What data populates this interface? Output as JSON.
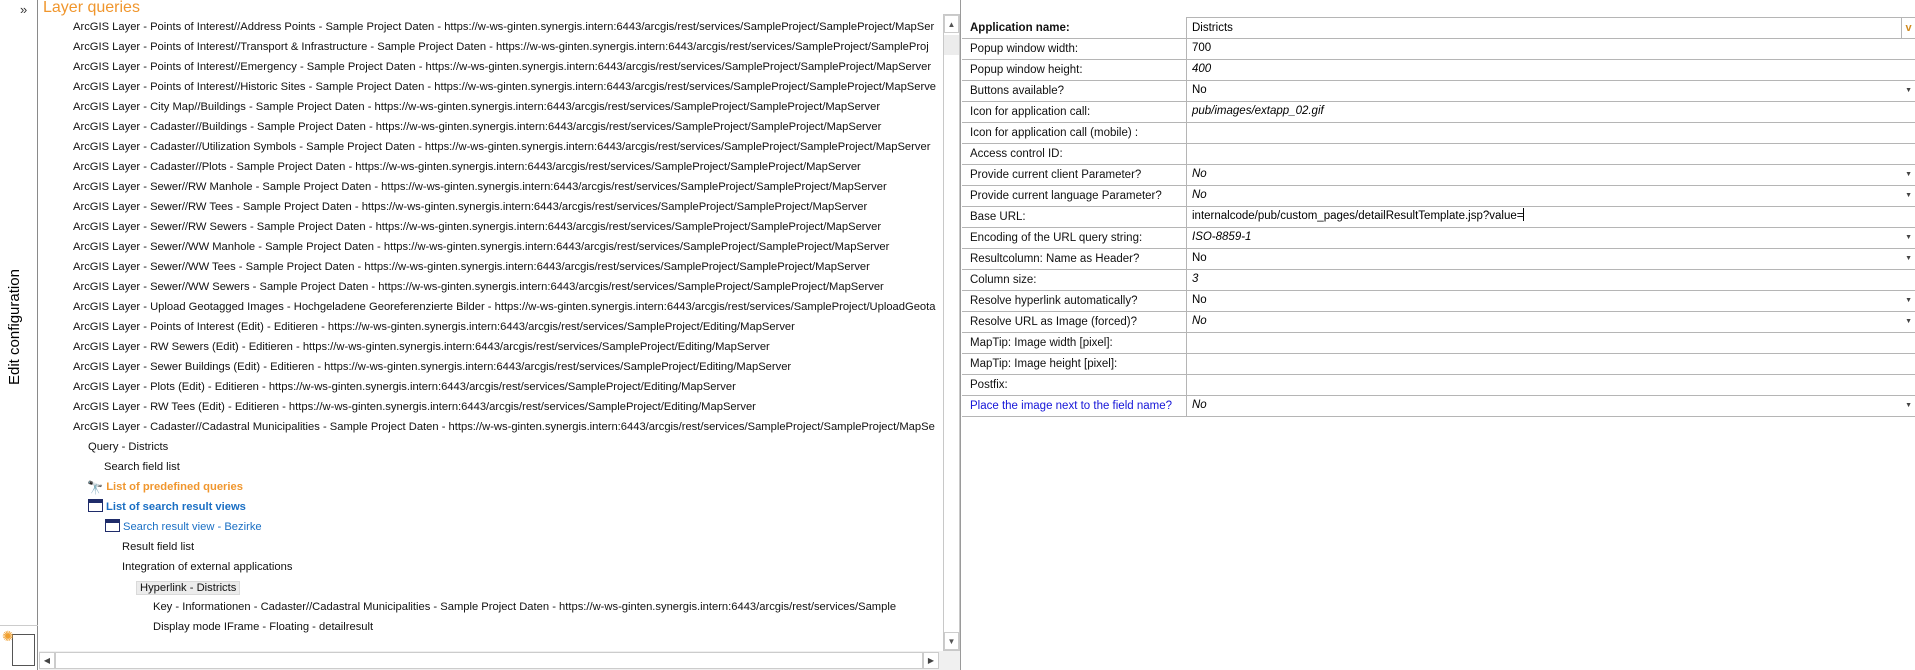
{
  "sidebar": {
    "expand_label": "»",
    "vertical_label": "Edit configuration"
  },
  "tree": {
    "title": "Layer queries",
    "layers": [
      "ArcGIS Layer - Points of Interest//Address Points - Sample Project Daten - https://w-ws-ginten.synergis.intern:6443/arcgis/rest/services/SampleProject/SampleProject/MapSer",
      "ArcGIS Layer - Points of Interest//Transport & Infrastructure - Sample Project Daten - https://w-ws-ginten.synergis.intern:6443/arcgis/rest/services/SampleProject/SampleProj",
      "ArcGIS Layer - Points of Interest//Emergency - Sample Project Daten - https://w-ws-ginten.synergis.intern:6443/arcgis/rest/services/SampleProject/SampleProject/MapServer",
      "ArcGIS Layer - Points of Interest//Historic Sites - Sample Project Daten - https://w-ws-ginten.synergis.intern:6443/arcgis/rest/services/SampleProject/SampleProject/MapServe",
      "ArcGIS Layer - City Map//Buildings - Sample Project Daten - https://w-ws-ginten.synergis.intern:6443/arcgis/rest/services/SampleProject/SampleProject/MapServer",
      "ArcGIS Layer - Cadaster//Buildings - Sample Project Daten - https://w-ws-ginten.synergis.intern:6443/arcgis/rest/services/SampleProject/SampleProject/MapServer",
      "ArcGIS Layer - Cadaster//Utilization Symbols - Sample Project Daten - https://w-ws-ginten.synergis.intern:6443/arcgis/rest/services/SampleProject/SampleProject/MapServer",
      "ArcGIS Layer - Cadaster//Plots - Sample Project Daten - https://w-ws-ginten.synergis.intern:6443/arcgis/rest/services/SampleProject/SampleProject/MapServer",
      "ArcGIS Layer - Sewer//RW Manhole - Sample Project Daten - https://w-ws-ginten.synergis.intern:6443/arcgis/rest/services/SampleProject/SampleProject/MapServer",
      "ArcGIS Layer - Sewer//RW Tees - Sample Project Daten - https://w-ws-ginten.synergis.intern:6443/arcgis/rest/services/SampleProject/SampleProject/MapServer",
      "ArcGIS Layer - Sewer//RW Sewers - Sample Project Daten - https://w-ws-ginten.synergis.intern:6443/arcgis/rest/services/SampleProject/SampleProject/MapServer",
      "ArcGIS Layer - Sewer//WW Manhole - Sample Project Daten - https://w-ws-ginten.synergis.intern:6443/arcgis/rest/services/SampleProject/SampleProject/MapServer",
      "ArcGIS Layer - Sewer//WW Tees - Sample Project Daten - https://w-ws-ginten.synergis.intern:6443/arcgis/rest/services/SampleProject/SampleProject/MapServer",
      "ArcGIS Layer - Sewer//WW Sewers - Sample Project Daten - https://w-ws-ginten.synergis.intern:6443/arcgis/rest/services/SampleProject/SampleProject/MapServer",
      "ArcGIS Layer - Upload Geotagged Images - Hochgeladene Georeferenzierte Bilder - https://w-ws-ginten.synergis.intern:6443/arcgis/rest/services/SampleProject/UploadGeota",
      "ArcGIS Layer - Points of Interest (Edit) - Editieren - https://w-ws-ginten.synergis.intern:6443/arcgis/rest/services/SampleProject/Editing/MapServer",
      "ArcGIS Layer - RW Sewers (Edit) - Editieren - https://w-ws-ginten.synergis.intern:6443/arcgis/rest/services/SampleProject/Editing/MapServer",
      "ArcGIS Layer - Sewer Buildings (Edit) - Editieren - https://w-ws-ginten.synergis.intern:6443/arcgis/rest/services/SampleProject/Editing/MapServer",
      "ArcGIS Layer - Plots (Edit) - Editieren - https://w-ws-ginten.synergis.intern:6443/arcgis/rest/services/SampleProject/Editing/MapServer",
      "ArcGIS Layer - RW Tees (Edit) - Editieren - https://w-ws-ginten.synergis.intern:6443/arcgis/rest/services/SampleProject/Editing/MapServer",
      "ArcGIS Layer - Cadaster//Cadastral Municipalities - Sample Project Daten - https://w-ws-ginten.synergis.intern:6443/arcgis/rest/services/SampleProject/SampleProject/MapSe"
    ],
    "query": "Query - Districts",
    "search_field_list": "Search field list",
    "predefined_queries": "List of predefined queries",
    "search_result_views": "List of search result views",
    "search_result_view": "Search result view - Bezirke",
    "result_field_list": "Result field list",
    "integration": "Integration of external applications",
    "hyperlink": "Hyperlink - Districts",
    "key": "Key - Informationen - Cadaster//Cadastral Municipalities - Sample Project Daten - https://w-ws-ginten.synergis.intern:6443/arcgis/rest/services/Sample",
    "display_mode": "Display mode IFrame - Floating - detailresult"
  },
  "properties": [
    {
      "label": "Application name:",
      "value": "Districts"
    },
    {
      "label": "Popup window width:",
      "value": "700"
    },
    {
      "label": "Popup window height:",
      "value": "400"
    },
    {
      "label": "Buttons available?",
      "value": "No"
    },
    {
      "label": "Icon for application call:",
      "value": "pub/images/extapp_02.gif"
    },
    {
      "label": "Icon for application call (mobile) :",
      "value": ""
    },
    {
      "label": "Access control ID:",
      "value": ""
    },
    {
      "label": "Provide current client Parameter?",
      "value": "No"
    },
    {
      "label": "Provide current language Parameter?",
      "value": "No"
    },
    {
      "label": "Base URL:",
      "value": "internalcode/pub/custom_pages/detailResultTemplate.jsp?value="
    },
    {
      "label": "Encoding of the URL query string:",
      "value": "ISO-8859-1"
    },
    {
      "label": "Resultcolumn: Name as Header?",
      "value": "No"
    },
    {
      "label": "Column size:",
      "value": "3"
    },
    {
      "label": "Resolve hyperlink automatically?",
      "value": "No"
    },
    {
      "label": "Resolve URL as Image (forced)?",
      "value": "No"
    },
    {
      "label": "MapTip: Image width [pixel]:",
      "value": ""
    },
    {
      "label": "MapTip: Image height [pixel]:",
      "value": ""
    },
    {
      "label": "Postfix:",
      "value": ""
    },
    {
      "label": "Place the image next to the field name?",
      "value": "No"
    }
  ],
  "app_name_button": "v"
}
